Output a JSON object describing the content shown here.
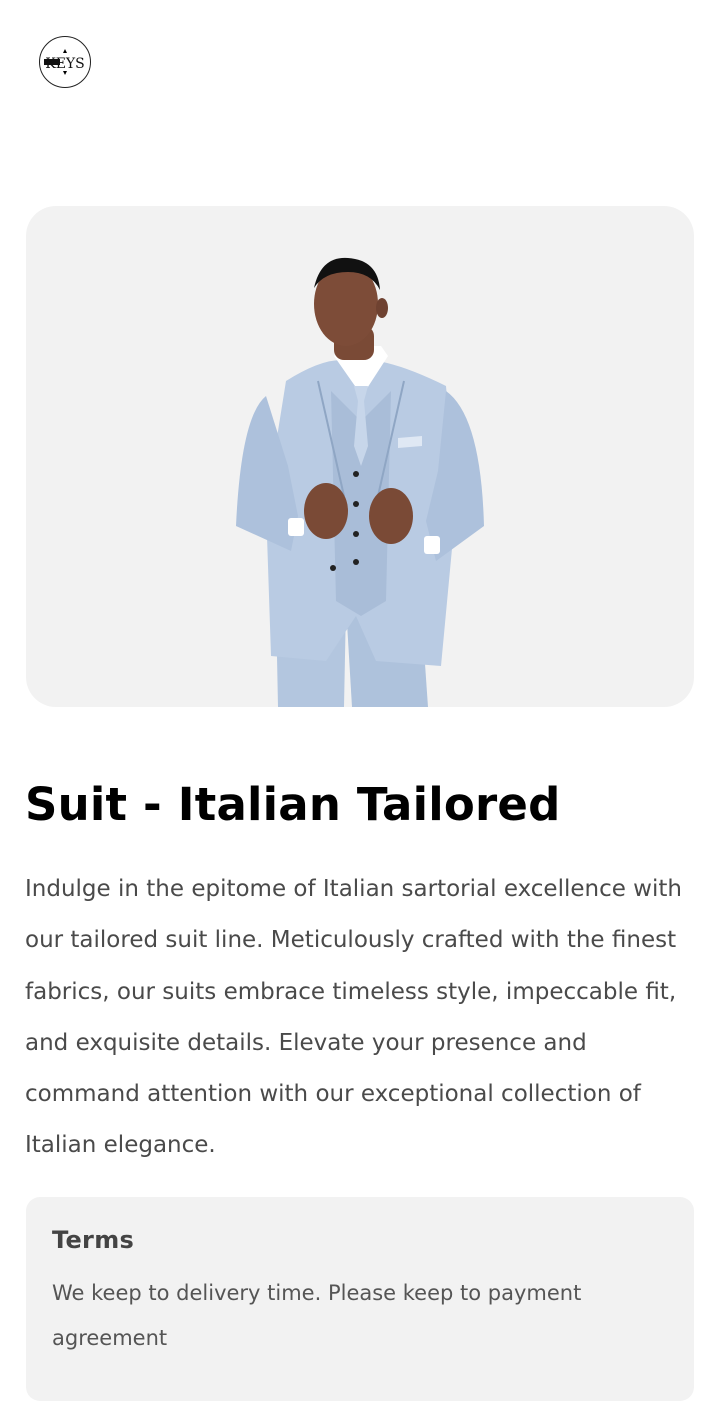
{
  "brand": {
    "logo_text": "KEYS",
    "logo_icon": "brand-logo-icon"
  },
  "product": {
    "image_alt": "Model wearing light blue three-piece suit",
    "image_icon": "product-photo",
    "title": "Suit - Italian Tailored",
    "description": "Indulge in the epitome of Italian sartorial excellence with our tailored suit line. Meticulously crafted with the finest fabrics, our suits embrace timeless style, impeccable fit, and exquisite details. Elevate your presence and command attention with our exceptional collection of Italian elegance."
  },
  "terms": {
    "heading": "Terms",
    "text": "We keep to delivery time. Please keep to payment agreement"
  },
  "colors": {
    "card_background": "#f2f2f2",
    "suit": "#b7c9e2",
    "text_primary": "#000000",
    "text_secondary": "#4a4a4a"
  }
}
